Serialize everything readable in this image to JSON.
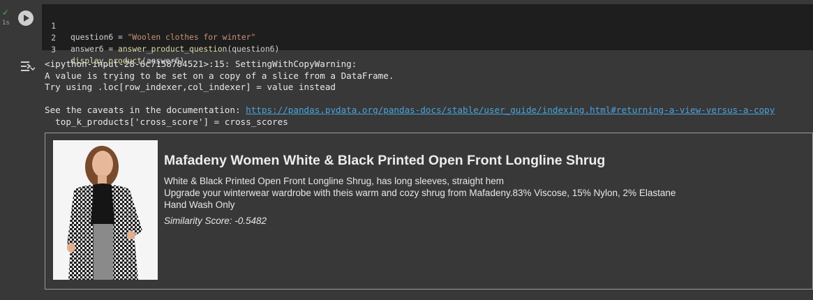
{
  "cell": {
    "exec_time": "1s",
    "code_lines": [
      {
        "num": "1",
        "pre": "question6 = ",
        "str": "\"Woolen clothes for winter\"",
        "post": ""
      },
      {
        "num": "2",
        "pre": "answer6 = ",
        "func": "answer_product_question",
        "post": "(question6)"
      },
      {
        "num": "3",
        "func": "display_product",
        "post": "(answer6)"
      }
    ]
  },
  "output": {
    "warning_lines": [
      "<ipython-input-28-6c7158784521>:15: SettingWithCopyWarning:",
      "A value is trying to be set on a copy of a slice from a DataFrame.",
      "Try using .loc[row_indexer,col_indexer] = value instead",
      "",
      "  top_k_products['cross_score'] = cross_scores"
    ],
    "caveat_prefix": "See the caveats in the documentation: ",
    "caveat_link": "https://pandas.pydata.org/pandas-docs/stable/user_guide/indexing.html#returning-a-view-versus-a-copy"
  },
  "product": {
    "title": "Mafadeny Women White & Black Printed Open Front Longline Shrug",
    "description": "White & Black Printed Open Front Longline Shrug, has long sleeves, straight hem\nUpgrade your winterwear wardrobe with theis warm and cozy shrug from Mafadeny.83% Viscose, 15% Nylon, 2% Elastane\nHand Wash Only",
    "score": "Similarity Score: -0.5482"
  },
  "colors": {
    "background": "#383838",
    "editor": "#1e1e1e",
    "string": "#ce9178",
    "function": "#dcdcaa",
    "link": "#4aa3df",
    "success": "#4caf50"
  }
}
